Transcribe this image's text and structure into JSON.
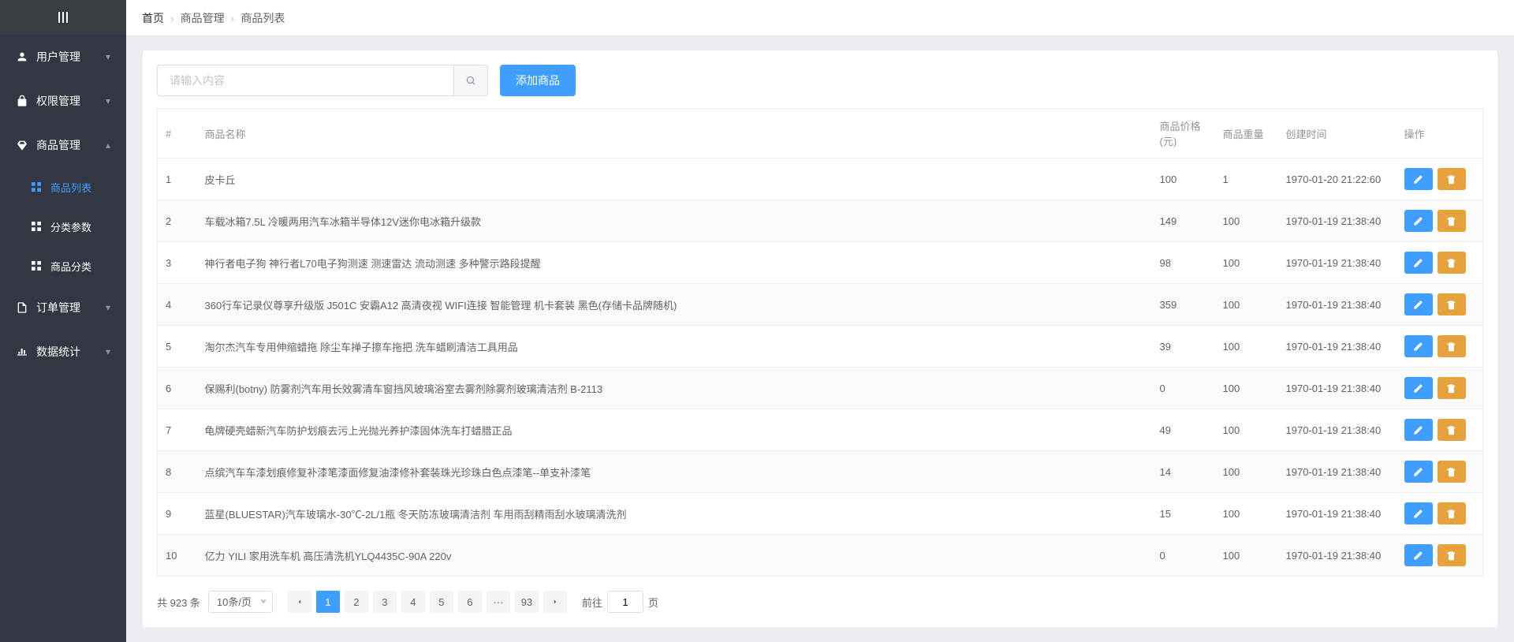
{
  "breadcrumb": {
    "home": "首页",
    "mid": "商品管理",
    "last": "商品列表"
  },
  "toolbar": {
    "search_placeholder": "请输入内容",
    "add_label": "添加商品"
  },
  "sidebar": {
    "items": [
      {
        "label": "用户管理",
        "icon": "user-icon"
      },
      {
        "label": "权限管理",
        "icon": "lock-icon"
      },
      {
        "label": "商品管理",
        "icon": "goods-icon",
        "expanded": true,
        "children": [
          {
            "label": "商品列表",
            "active": true,
            "icon": "grid-icon"
          },
          {
            "label": "分类参数",
            "icon": "grid-icon"
          },
          {
            "label": "商品分类",
            "icon": "grid-icon"
          }
        ]
      },
      {
        "label": "订单管理",
        "icon": "order-icon"
      },
      {
        "label": "数据统计",
        "icon": "stats-icon"
      }
    ]
  },
  "table": {
    "headers": {
      "idx": "#",
      "name": "商品名称",
      "price": "商品价格(元)",
      "weight": "商品重量",
      "time": "创建时间",
      "action": "操作"
    },
    "rows": [
      {
        "idx": "1",
        "name": "皮卡丘",
        "price": "100",
        "weight": "1",
        "time": "1970-01-20 21:22:60"
      },
      {
        "idx": "2",
        "name": "车载冰箱7.5L 冷暖两用汽车冰箱半导体12V迷你电冰箱升级款",
        "price": "149",
        "weight": "100",
        "time": "1970-01-19 21:38:40"
      },
      {
        "idx": "3",
        "name": "神行者电子狗 神行者L70电子狗测速 测速雷达 流动测速 多种警示路段提醒",
        "price": "98",
        "weight": "100",
        "time": "1970-01-19 21:38:40"
      },
      {
        "idx": "4",
        "name": "360行车记录仪尊享升级版 J501C 安霸A12 高清夜视 WIFI连接 智能管理 机卡套装 黑色(存储卡品牌随机)",
        "price": "359",
        "weight": "100",
        "time": "1970-01-19 21:38:40"
      },
      {
        "idx": "5",
        "name": "淘尔杰汽车专用伸缩蜡拖 除尘车掸子擦车拖把 洗车蜡刷清洁工具用品",
        "price": "39",
        "weight": "100",
        "time": "1970-01-19 21:38:40"
      },
      {
        "idx": "6",
        "name": "保赐利(botny) 防雾剂汽车用长效雾清车窗挡风玻璃浴室去雾剂除雾剂玻璃清洁剂 B-2113",
        "price": "0",
        "weight": "100",
        "time": "1970-01-19 21:38:40"
      },
      {
        "idx": "7",
        "name": "龟牌硬壳蜡新汽车防护划痕去污上光抛光养护漆固体洗车打蜡腊正品",
        "price": "49",
        "weight": "100",
        "time": "1970-01-19 21:38:40"
      },
      {
        "idx": "8",
        "name": "点缤汽车车漆划痕修复补漆笔漆面修复油漆修补套装珠光珍珠白色点漆笔--单支补漆笔",
        "price": "14",
        "weight": "100",
        "time": "1970-01-19 21:38:40"
      },
      {
        "idx": "9",
        "name": "蓝星(BLUESTAR)汽车玻璃水-30℃-2L/1瓶 冬天防冻玻璃清洁剂 车用雨刮精雨刮水玻璃清洗剂",
        "price": "15",
        "weight": "100",
        "time": "1970-01-19 21:38:40"
      },
      {
        "idx": "10",
        "name": "亿力 YILI 家用洗车机 高压清洗机YLQ4435C-90A 220v",
        "price": "0",
        "weight": "100",
        "time": "1970-01-19 21:38:40"
      }
    ]
  },
  "pagination": {
    "total_text": "共 923 条",
    "per_page": "10条/页",
    "pages": [
      "1",
      "2",
      "3",
      "4",
      "5",
      "6"
    ],
    "ellipsis": "···",
    "last": "93",
    "jump_prefix": "前往",
    "jump_value": "1",
    "jump_suffix": "页"
  }
}
